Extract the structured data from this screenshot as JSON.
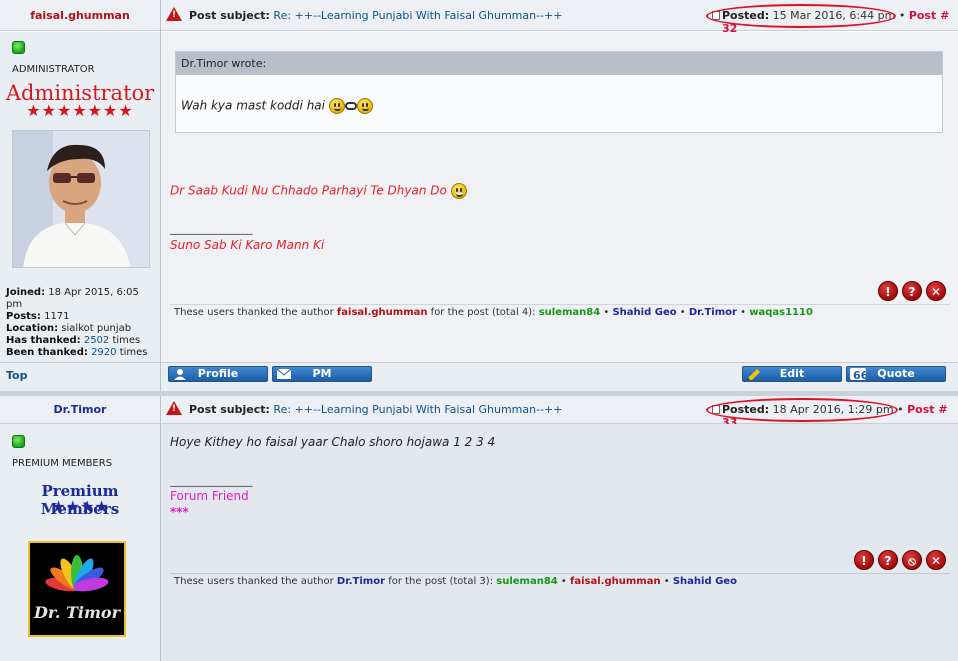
{
  "post1": {
    "username": "faisal.ghumman",
    "username_color": "#b31212",
    "subject_label": "Post subject:",
    "subject_text": "Re: ++--Learning Punjabi With Faisal Ghumman--++",
    "posted_label": "Posted:",
    "posted_date": "15 Mar 2016, 6:44 pm",
    "bullet": "•",
    "post_number": "Post # 32",
    "rank": "ADMINISTRATOR",
    "rank_title": "Administrator",
    "rank_stars": "★★★★★★★",
    "joined_label": "Joined:",
    "joined_value": "18 Apr 2015, 6:05 pm",
    "posts_label": "Posts:",
    "posts_value": "1171",
    "location_label": "Location:",
    "location_value": "sialkot punjab",
    "has_thanked_label": "Has thanked:",
    "has_thanked_value": "2502",
    "been_thanked_label": "Been thanked:",
    "been_thanked_value": "2920",
    "times": "times",
    "quote_author": "Dr.Timor wrote:",
    "quote_text": "Wah kya mast koddi hai",
    "body_line": "Dr Saab Kudi Nu Chhado Parhayi Te Dhyan Do",
    "sig_rule": "_______________",
    "signature": "Suno Sab Ki Karo Mann Ki",
    "thanks_prefix": "These users thanked the author",
    "thanks_author": "faisal.ghumman",
    "thanks_suffix": "for the post (total 4):",
    "thanks_users": [
      {
        "name": "suleman84",
        "color": "#179617"
      },
      {
        "name": "Shahid Geo",
        "color": "#1a2a9a"
      },
      {
        "name": "Dr.Timor",
        "color": "#1a2a9a"
      },
      {
        "name": "waqas1110",
        "color": "#179617"
      }
    ],
    "top_link": "Top",
    "profile_btn": "Profile",
    "pm_btn": "PM",
    "edit_btn": "Edit",
    "quote_btn": "Quote",
    "avatar_icon": "user-photo"
  },
  "post2": {
    "username": "Dr.Timor",
    "username_color": "#1a2a9a",
    "subject_label": "Post subject:",
    "subject_text": "Re: ++--Learning Punjabi With Faisal Ghumman--++",
    "posted_label": "Posted:",
    "posted_date": "18 Apr 2016, 1:29 pm",
    "bullet": "•",
    "post_number": "Post # 33",
    "rank": "PREMIUM MEMBERS",
    "rank_title": "Premium Members",
    "rank_stars": "★★★★",
    "avatar_text": "Dr. Timor",
    "body_line": "Hoye Kithey ho faisal yaar Chalo shoro hojawa 1 2 3 4",
    "sig_rule": "_______________",
    "signature": "Forum Friend",
    "signature2": "***",
    "thanks_prefix": "These users thanked the author",
    "thanks_author": "Dr.Timor",
    "thanks_suffix": "for the post (total 3):",
    "thanks_users": [
      {
        "name": "suleman84",
        "color": "#179617"
      },
      {
        "name": "faisal.ghumman",
        "color": "#b31212"
      },
      {
        "name": "Shahid Geo",
        "color": "#1a2a9a"
      }
    ]
  },
  "icons": {
    "report": "!",
    "info": "?",
    "warn": "⦸",
    "delete": "✕",
    "warning_triangle": "!"
  }
}
